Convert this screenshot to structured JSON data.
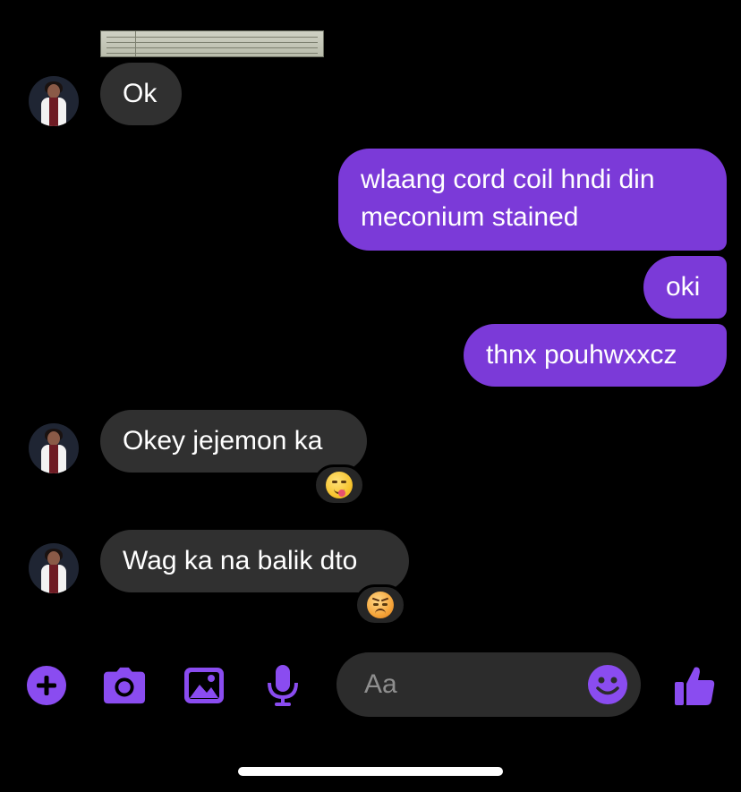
{
  "conversation": {
    "messages": [
      {
        "id": "m1",
        "side": "in",
        "text": "Ok"
      },
      {
        "id": "m2",
        "side": "out",
        "text": "wlaang cord coil hndi din\nmeconium stained"
      },
      {
        "id": "m3",
        "side": "out",
        "text": "oki"
      },
      {
        "id": "m4",
        "side": "out",
        "text": "thnx pouhwxxcz"
      },
      {
        "id": "m5",
        "side": "in",
        "text": "Okey jejemon ka",
        "reaction": "yum-face-emoji"
      },
      {
        "id": "m6",
        "side": "in",
        "text": "Wag ka na balik dto",
        "reaction": "angry-face-emoji"
      }
    ]
  },
  "composer": {
    "placeholder": "Aa",
    "actions": [
      "add",
      "camera",
      "gallery",
      "microphone"
    ],
    "send_action": "like"
  },
  "colors": {
    "background": "#000000",
    "incoming_bubble": "#303030",
    "outgoing_bubble": "#7b3ad8",
    "accent": "#8a4cf0",
    "composer_bg": "#2c2c2c"
  },
  "icons": {
    "add": "plus-circle-icon",
    "camera": "camera-icon",
    "gallery": "image-icon",
    "microphone": "microphone-icon",
    "emoji": "smiley-icon",
    "send": "thumbs-up-icon"
  }
}
